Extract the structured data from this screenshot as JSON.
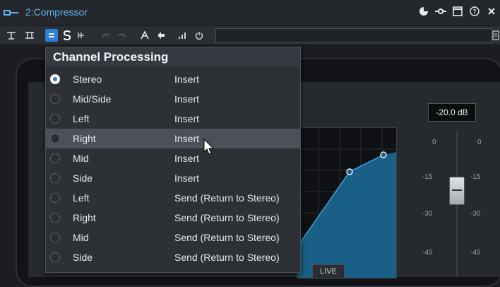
{
  "window": {
    "title": "2:Compressor"
  },
  "toolbar": {
    "preset_value": ""
  },
  "channel_menu": {
    "header": "Channel Processing",
    "items": [
      {
        "label": "Stereo",
        "mode": "Insert",
        "selected": true,
        "highlighted": false
      },
      {
        "label": "Mid/Side",
        "mode": "Insert",
        "selected": false,
        "highlighted": false
      },
      {
        "label": "Left",
        "mode": "Insert",
        "selected": false,
        "highlighted": false
      },
      {
        "label": "Right",
        "mode": "Insert",
        "selected": false,
        "highlighted": true
      },
      {
        "label": "Mid",
        "mode": "Insert",
        "selected": false,
        "highlighted": false
      },
      {
        "label": "Side",
        "mode": "Insert",
        "selected": false,
        "highlighted": false
      },
      {
        "label": "Left",
        "mode": "Send (Return to Stereo)",
        "selected": false,
        "highlighted": false
      },
      {
        "label": "Right",
        "mode": "Send (Return to Stereo)",
        "selected": false,
        "highlighted": false
      },
      {
        "label": "Mid",
        "mode": "Send (Return to Stereo)",
        "selected": false,
        "highlighted": false
      },
      {
        "label": "Side",
        "mode": "Send (Return to Stereo)",
        "selected": false,
        "highlighted": false
      }
    ]
  },
  "compressor": {
    "gain_readout": "-20.0 dB",
    "live_label": "LIVE",
    "scale_left": [
      "0",
      "-15",
      "-30",
      "-45"
    ],
    "scale_right": [
      "0",
      "-15",
      "-30",
      "-45"
    ]
  },
  "colors": {
    "accent": "#2f7fd6",
    "title_text": "#5fb6f2",
    "curve_fill": "#1a5f86"
  }
}
